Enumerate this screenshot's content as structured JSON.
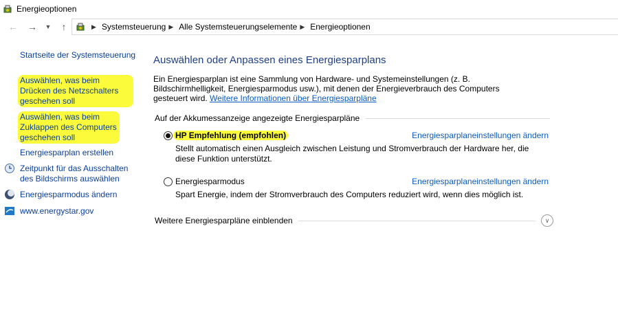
{
  "window": {
    "title": "Energieoptionen"
  },
  "breadcrumb": [
    "Systemsteuerung",
    "Alle Systemsteuerungselemente",
    "Energieoptionen"
  ],
  "sidebar": {
    "home": "Startseite der Systemsteuerung",
    "links": [
      "Auswählen, was beim Drücken des Netzschalters geschehen soll",
      "Auswählen, was beim Zuklappen des Computers geschehen soll",
      "Energiesparplan erstellen",
      "Zeitpunkt für das Ausschalten des Bildschirms auswählen",
      "Energiesparmodus ändern",
      "www.energystar.gov"
    ]
  },
  "main": {
    "title": "Auswählen oder Anpassen eines Energiesparplans",
    "description": "Ein Energiesparplan ist eine Sammlung von Hardware- und Systemeinstellungen (z. B. Bildschirmhelligkeit, Energiesparmodus usw.), mit denen der Energieverbrauch des Computers gesteuert wird.",
    "more_info_link": "Weitere Informationen über Energiesparpläne",
    "group_label": "Auf der Akkumessanzeige angezeigte Energiesparpläne",
    "plans": [
      {
        "name": "HP Empfehlung (empfohlen)",
        "selected": true,
        "change_link": "Energiesparplaneinstellungen ändern",
        "description": "Stellt automatisch einen Ausgleich zwischen Leistung und Stromverbrauch der Hardware her, die diese Funktion unterstützt."
      },
      {
        "name": "Energiesparmodus",
        "selected": false,
        "change_link": "Energiesparplaneinstellungen ändern",
        "description": "Spart Energie, indem der Stromverbrauch des Computers reduziert wird, wenn dies möglich ist."
      }
    ],
    "more_plans": "Weitere Energiesparpläne einblenden"
  },
  "colors": {
    "link": "#0a5bc4",
    "highlight": "#fbfb3b",
    "title": "#1e3f88"
  }
}
